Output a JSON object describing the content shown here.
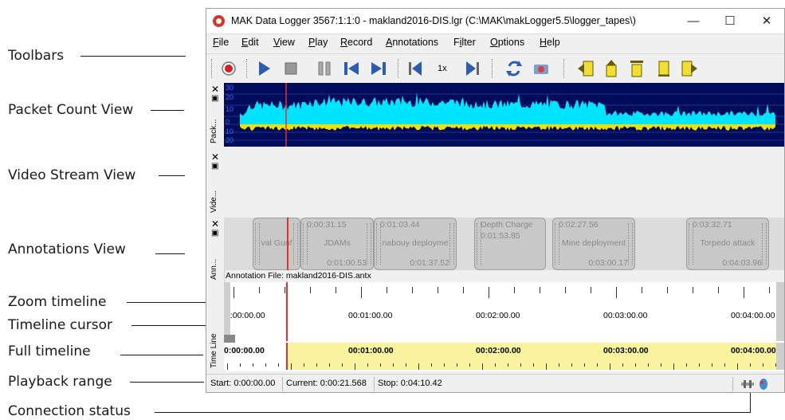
{
  "callouts": {
    "toolbars": "Toolbars",
    "packet_count_view": "Packet Count View",
    "video_stream_view": "Video Stream View",
    "annotations_view": "Annotations View",
    "zoom_timeline": "Zoom timeline",
    "timeline_cursor": "Timeline cursor",
    "full_timeline": "Full timeline",
    "playback_range": "Playback range",
    "connection_status": "Connection status"
  },
  "window": {
    "title": "MAK Data Logger 3567:1:1:0 - makland2016-DIS.lgr (C:\\MAK\\makLogger5.5\\logger_tapes\\)",
    "minimize": "—",
    "maximize": "☐",
    "close": "✕"
  },
  "menu": [
    {
      "u": "F",
      "rest": "ile"
    },
    {
      "u": "E",
      "rest": "dit"
    },
    {
      "u": "V",
      "rest": "iew"
    },
    {
      "u": "P",
      "rest": "lay"
    },
    {
      "u": "R",
      "rest": "ecord"
    },
    {
      "u": "A",
      "rest": "nnotations"
    },
    {
      "u": "F",
      "rest": "ilter",
      "pre": ""
    },
    {
      "u": "O",
      "rest": "ptions"
    },
    {
      "u": "H",
      "rest": "elp"
    }
  ],
  "toolbar": {
    "speed_label": "1x",
    "icons": [
      "record-icon",
      "play-icon",
      "stop-icon",
      "pause-icon",
      "skip-start-icon",
      "skip-end-icon",
      "slower-icon",
      "faster-icon",
      "loop-icon",
      "camera-icon",
      "annotation-prev-icon",
      "annotation-up-icon",
      "annotation-top-icon",
      "annotation-add-icon",
      "annotation-next-icon"
    ]
  },
  "colors": {
    "packet_bg": "#000c5a",
    "packet_fill": "#00e5ff",
    "packet_under": "#f0e000",
    "cursor": "#e03030",
    "full_timeline_fill": "#faf49e",
    "title_accent": "#d7352a"
  },
  "packet_view": {
    "dock_label": "Pack...",
    "y_ticks": [
      "30",
      "20",
      "10",
      "0",
      "10",
      "20"
    ]
  },
  "video_view": {
    "dock_label": "Vide..."
  },
  "annotations_view": {
    "dock_label": "Ann...",
    "file_label": "Annotation File: makland2016-DIS.antx",
    "cards": [
      {
        "start": "",
        "name": "val Gunf",
        "end": ""
      },
      {
        "start": "0:00:31.15",
        "name": "JDAMs",
        "end": "0:01:00.53"
      },
      {
        "start": "0:01:03.44",
        "name": "nabouy deployme",
        "end": "0:01:37.52"
      },
      {
        "start": "Depth Charge",
        "name": "0:01:53.85",
        "end": ""
      },
      {
        "start": "0:02:27.56",
        "name": "Mine deployment",
        "end": "0:03:00.17"
      },
      {
        "start": "0:03:32.71",
        "name": "Torpedo attack",
        "end": "0:04:03.96"
      }
    ]
  },
  "timeline": {
    "dock_label": "Time Line",
    "zoom_labels": [
      "0:00:00.00",
      "00:01:00.00",
      "00:02:00.00",
      "00:03:00.00",
      "00:04:00.00"
    ],
    "full_labels": [
      "0:00:00.00",
      "00:01:00.00",
      "00:02:00.00",
      "00:03:00.00",
      "00:04:00.00"
    ]
  },
  "status": {
    "start": "Start: 0:00:00.00",
    "current": "Current: 0:00:21.568",
    "stop": "Stop: 0:04:10.42"
  }
}
